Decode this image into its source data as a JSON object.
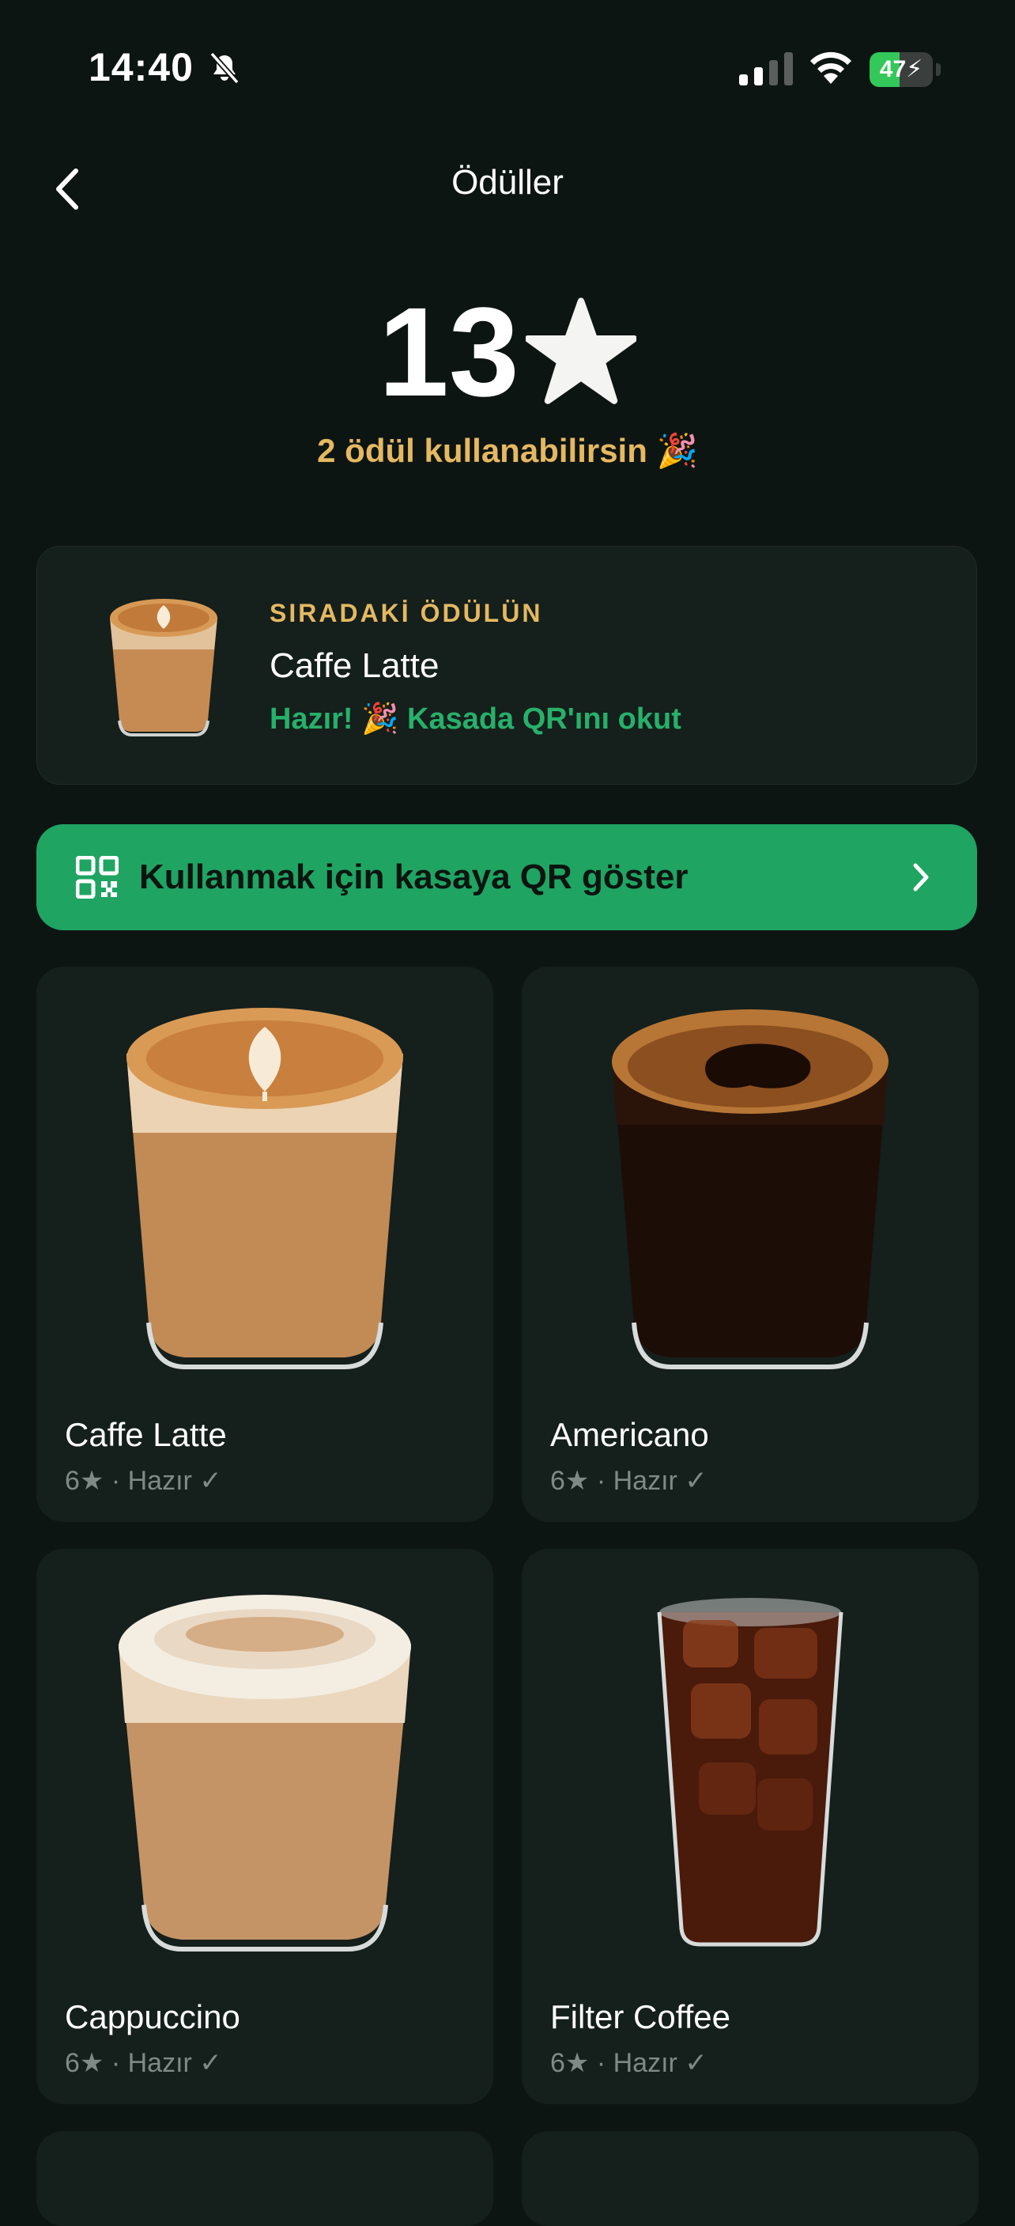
{
  "status_bar": {
    "time": "14:40",
    "battery_percent": 47,
    "battery_label": "47"
  },
  "header": {
    "title": "Ödüller"
  },
  "summary": {
    "stars": "13",
    "available_text": "2 ödül kullanabilirsin 🎉"
  },
  "next_reward": {
    "label": "SIRADAKİ ÖDÜLÜN",
    "title": "Caffe Latte",
    "status": "Hazır! 🎉 Kasada QR'ını okut"
  },
  "qr_button": {
    "label": "Kullanmak için kasaya QR göster"
  },
  "rewards": [
    {
      "name": "Caffe Latte",
      "meta": "6★ · Hazır ✓"
    },
    {
      "name": "Americano",
      "meta": "6★ · Hazır ✓"
    },
    {
      "name": "Cappuccino",
      "meta": "6★ · Hazır ✓"
    },
    {
      "name": "Filter Coffee",
      "meta": "6★ · Hazır ✓"
    }
  ],
  "colors": {
    "background": "#0d1513",
    "card": "#151f1c",
    "accent_green": "#1fa462",
    "gold": "#e5b861",
    "status_green": "#27b06a"
  }
}
